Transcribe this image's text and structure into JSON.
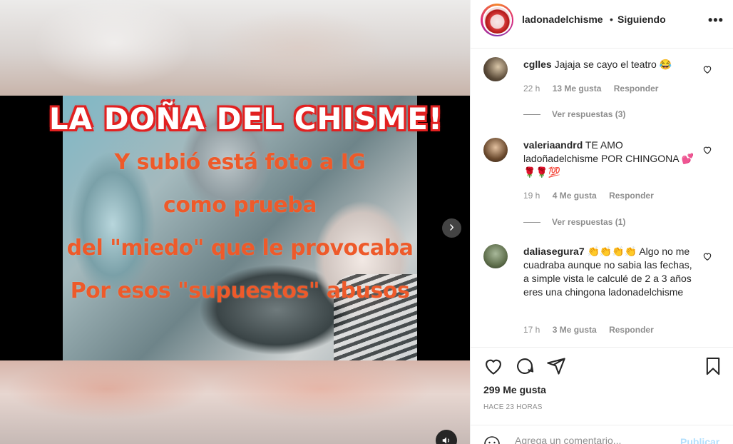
{
  "media": {
    "overlay_title": "La doña del chisme!",
    "overlay_lines": [
      "Y subió está foto a IG",
      "como prueba",
      "del \"miedo\" que le provocaba",
      "Por esos \"supuestos\" abusos"
    ],
    "next_icon": "chevron-right-icon",
    "sound_icon": "speaker-icon"
  },
  "header": {
    "username": "ladonadelchisme",
    "separator": "•",
    "follow_status": "Siguiendo",
    "more_icon": "•••"
  },
  "comments": [
    {
      "username": "cglles",
      "text": "Jajaja se cayo el teatro 😂",
      "time": "22 h",
      "likes": "13 Me gusta",
      "reply": "Responder",
      "view_replies": "Ver respuestas (3)"
    },
    {
      "username": "valeriaandrd",
      "text": "TE AMO ladoñadelchisme POR CHINGONA 💕🌹🌹💯",
      "time": "19 h",
      "likes": "4 Me gusta",
      "reply": "Responder",
      "view_replies": "Ver respuestas (1)"
    },
    {
      "username": "daliasegura7",
      "text": "👏👏👏👏 Algo no me cuadraba aunque no sabia las fechas, a simple vista le calculé de 2 a 3 años eres una chingona ladonadelchisme",
      "time": "17 h",
      "likes": "3 Me gusta",
      "reply": "Responder"
    }
  ],
  "actions": {
    "likes_count": "299 Me gusta",
    "timestamp": "HACE 23 HORAS"
  },
  "add_comment": {
    "placeholder": "Agrega un comentario...",
    "publish_label": "Publicar"
  }
}
